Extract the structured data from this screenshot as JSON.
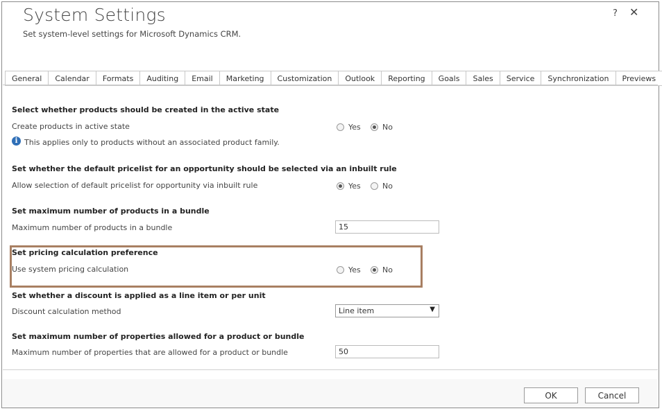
{
  "dialog": {
    "title": "System Settings",
    "subtitle": "Set system-level settings for Microsoft Dynamics CRM.",
    "help_label": "?",
    "close_label": "✕"
  },
  "tabs": [
    {
      "label": "General"
    },
    {
      "label": "Calendar"
    },
    {
      "label": "Formats"
    },
    {
      "label": "Auditing"
    },
    {
      "label": "Email"
    },
    {
      "label": "Marketing"
    },
    {
      "label": "Customization"
    },
    {
      "label": "Outlook"
    },
    {
      "label": "Reporting"
    },
    {
      "label": "Goals"
    },
    {
      "label": "Sales"
    },
    {
      "label": "Service"
    },
    {
      "label": "Synchronization"
    },
    {
      "label": "Previews"
    }
  ],
  "sections": {
    "active_state": {
      "heading": "Select whether products should be created in the active state",
      "label": "Create products in active state",
      "yes": "Yes",
      "no": "No",
      "selected": "No",
      "info": "This applies only to products without an associated product family."
    },
    "default_pricelist": {
      "heading": "Set whether the default pricelist for an opportunity should be selected via an inbuilt rule",
      "label": "Allow selection of default pricelist for opportunity via inbuilt rule",
      "yes": "Yes",
      "no": "No",
      "selected": "Yes"
    },
    "bundle_max": {
      "heading": "Set maximum number of products in a bundle",
      "label": "Maximum number of products in a bundle",
      "value": "15"
    },
    "pricing_calc": {
      "heading": "Set pricing calculation preference",
      "label": "Use system pricing calculation",
      "yes": "Yes",
      "no": "No",
      "selected": "No"
    },
    "discount": {
      "heading": "Set whether a discount is applied as a line item or per unit",
      "label": "Discount calculation method",
      "value": "Line item"
    },
    "properties_max": {
      "heading": "Set maximum number of properties allowed for a product or bundle",
      "label": "Maximum number of properties that are allowed for a product or bundle",
      "value": "50"
    }
  },
  "footer": {
    "ok_label": "OK",
    "cancel_label": "Cancel"
  },
  "colors": {
    "highlight_border": "#a87f62",
    "info_icon": "#2f6fb7"
  }
}
